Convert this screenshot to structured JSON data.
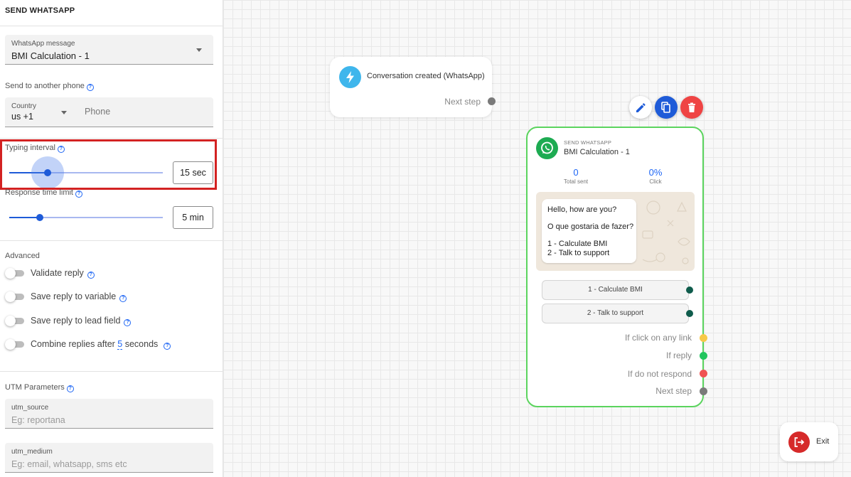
{
  "panel": {
    "title": "SEND WHATSAPP",
    "whatsapp_message": {
      "label": "WhatsApp message",
      "value": "BMI Calculation - 1"
    },
    "send_to_another_phone": "Send to another phone",
    "country": {
      "label": "Country",
      "value": "us +1"
    },
    "phone": {
      "placeholder": "Phone"
    },
    "typing_interval": {
      "label": "Typing interval",
      "value": "15 sec",
      "slider_fraction": 0.25
    },
    "response_time_limit": {
      "label": "Response time limit",
      "value": "5 min",
      "slider_fraction": 0.2
    },
    "advanced": {
      "label": "Advanced",
      "toggles": [
        {
          "label": "Validate reply",
          "on": false
        },
        {
          "label": "Save reply to variable",
          "on": false
        },
        {
          "label": "Save reply to lead field",
          "on": false
        }
      ],
      "combine": {
        "prefix": "Combine replies after",
        "number": "5",
        "suffix": "seconds",
        "on": false
      }
    },
    "utm": {
      "label": "UTM Parameters",
      "source": {
        "label": "utm_source",
        "placeholder": "Eg: reportana"
      },
      "medium": {
        "label": "utm_medium",
        "placeholder": "Eg: email, whatsapp, sms etc"
      }
    }
  },
  "canvas": {
    "trigger": {
      "title": "Conversation created (WhatsApp)",
      "next_step": "Next step",
      "icon": "bolt-icon"
    },
    "actions": {
      "edit": "pencil-icon",
      "duplicate": "copy-icon",
      "delete": "trash-icon"
    },
    "node": {
      "kicker": "SEND WHATSAPP",
      "title": "BMI Calculation - 1",
      "stats": [
        {
          "value": "0",
          "label": "Total sent"
        },
        {
          "value": "0%",
          "label": "Click"
        }
      ],
      "message_lines": [
        "Hello, how are you?",
        "O que gostaria de fazer?",
        "1 - Calculate BMI",
        "2 - Talk to support"
      ],
      "buttons": [
        "1 - Calculate BMI",
        "2 - Talk to support"
      ],
      "outputs": [
        {
          "label": "If click on any link",
          "color": "#f7c948"
        },
        {
          "label": "If reply",
          "color": "#22c55e"
        },
        {
          "label": "If do not respond",
          "color": "#f05252"
        },
        {
          "label": "Next step",
          "color": "#7a7a7a"
        }
      ]
    },
    "exit": {
      "label": "Exit",
      "icon": "exit-icon"
    }
  },
  "colors": {
    "accent": "#1e5bd8",
    "highlight": "#d32222",
    "whatsapp_green": "#1dab52",
    "button_dot": "#0f5c4c"
  }
}
